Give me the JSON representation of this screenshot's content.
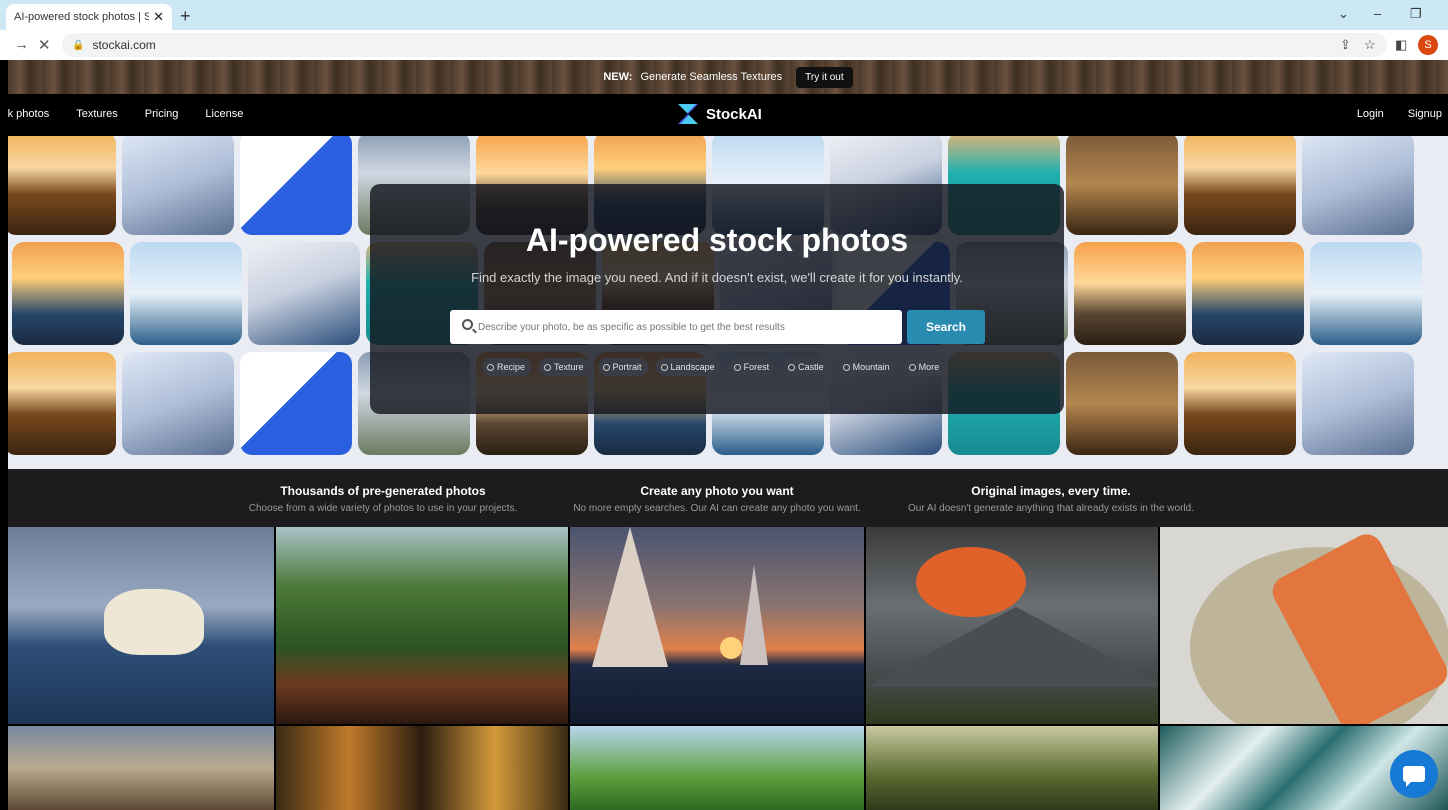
{
  "browser": {
    "tab_title": "AI-powered stock photos | Stock",
    "tab_close": "✕",
    "new_tab": "+",
    "url": "stockai.com",
    "profile_initial": "S"
  },
  "announcement": {
    "new_label": "NEW:",
    "text": "Generate Seamless Textures",
    "cta": "Try it out"
  },
  "nav": {
    "left_items": [
      "ock photos",
      "Textures",
      "Pricing",
      "License"
    ],
    "brand": "StockAI",
    "login": "Login",
    "signup": "Signup"
  },
  "hero": {
    "title": "AI-powered stock photos",
    "subtitle": "Find exactly the image you need. And if it doesn't exist, we'll create it for you instantly.",
    "search_placeholder": "Describe your photo, be as specific as possible to get the best results",
    "search_button": "Search",
    "chips": [
      "Recipe",
      "Texture",
      "Portrait",
      "Landscape",
      "Forest",
      "Castle",
      "Mountain",
      "More"
    ]
  },
  "features": [
    {
      "title": "Thousands of pre-generated photos",
      "desc": "Choose from a wide variety of photos to use in your projects."
    },
    {
      "title": "Create any photo you want",
      "desc": "No more empty searches. Our AI can create any photo you want."
    },
    {
      "title": "Original images, every time.",
      "desc": "Our AI doesn't generate anything that already exists in the world."
    }
  ],
  "colors": {
    "accent": "#2a8bb0",
    "chat": "#1679d6"
  }
}
